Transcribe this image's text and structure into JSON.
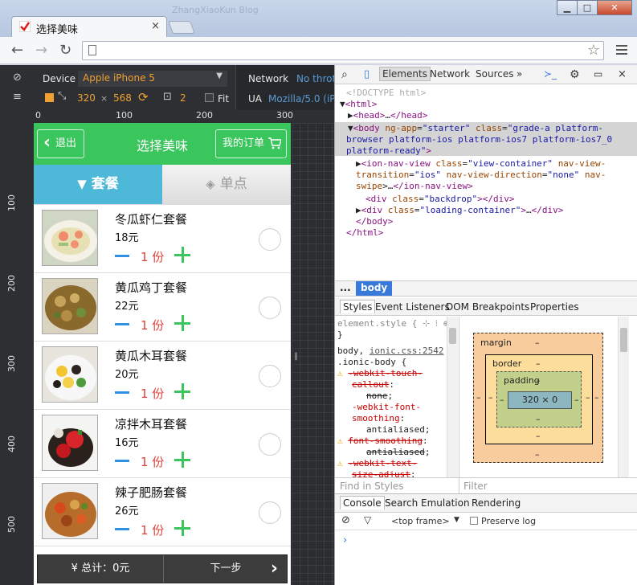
{
  "browser": {
    "tab_title": "选择美味",
    "ghost_tab_title": "ZhangXiaoKun Blog",
    "close_glyph": "×",
    "buttons": {
      "minimize": "▁",
      "maximize": "□",
      "close": "✕"
    }
  },
  "device_bar": {
    "device_label": "Device",
    "device_value": "Apple iPhone 5",
    "width": "320",
    "times": "×",
    "height": "568",
    "scale": "2",
    "fit_label": "Fit",
    "network_label": "Network",
    "network_value": "No throt",
    "ua_label": "UA",
    "ua_value": "Mozilla/5.0 (iPh"
  },
  "rulers": {
    "h": [
      "0",
      "100",
      "200",
      "300"
    ],
    "v": [
      "100",
      "200",
      "300",
      "400",
      "500"
    ]
  },
  "app": {
    "back_label": "退出",
    "title": "选择美味",
    "orders_label": "我的订单",
    "seg_set": "套餐",
    "seg_single": "单点",
    "items": [
      {
        "name": "冬瓜虾仁套餐",
        "price": "18元",
        "qty": "1 份"
      },
      {
        "name": "黄瓜鸡丁套餐",
        "price": "22元",
        "qty": "1 份"
      },
      {
        "name": "黄瓜木耳套餐",
        "price": "20元",
        "qty": "1 份"
      },
      {
        "name": "凉拌木耳套餐",
        "price": "16元",
        "qty": "1 份"
      },
      {
        "name": "辣子肥肠套餐",
        "price": "26元",
        "qty": "1 份"
      }
    ],
    "total_label": "总计：0元",
    "next_label": "下一步"
  },
  "devtools": {
    "tabs": [
      "Elements",
      "Network",
      "Sources",
      "»"
    ],
    "breadcrumb_dots": "...",
    "breadcrumb_body": "body",
    "subtabs": [
      "Styles",
      "Event Listeners",
      "DOM Breakpoints",
      "Properties"
    ],
    "box_model": {
      "margin": "margin",
      "border": "border",
      "padding": "padding",
      "dash": "–",
      "content": "320 × 0"
    },
    "find_placeholder": "Find in Styles",
    "filter_placeholder": "Filter",
    "console_tabs": [
      "Console",
      "Search",
      "Emulation",
      "Rendering"
    ],
    "frame": "<top frame>",
    "preserve_log": "Preserve log",
    "prompt": "›"
  },
  "icons": [
    "stop-icon",
    "inspect-icon",
    "mobile-icon",
    "settings-icon",
    "dock-icon",
    "close-icon",
    "cart-icon",
    "filter-icon",
    "rotate-icon"
  ]
}
